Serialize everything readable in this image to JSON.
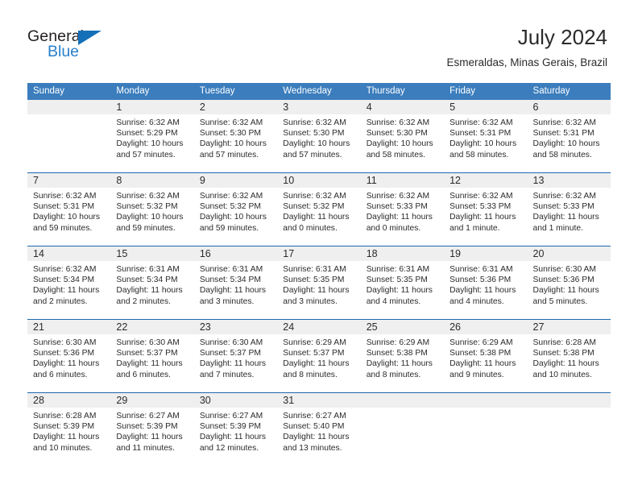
{
  "brand": {
    "word_one": "General",
    "word_two": "Blue",
    "triangle_icon": "triangle-icon",
    "accent_blue": "#2a7fc9",
    "dark": "#231f20"
  },
  "header": {
    "month_title": "July 2024",
    "location": "Esmeraldas, Minas Gerais, Brazil"
  },
  "calendar": {
    "header_bg": "#3b7dbd",
    "week_divider": "#1f69ad",
    "day_band_bg": "#efefef",
    "weekdays": [
      "Sunday",
      "Monday",
      "Tuesday",
      "Wednesday",
      "Thursday",
      "Friday",
      "Saturday"
    ],
    "weeks": [
      [
        {
          "day": "",
          "lines": []
        },
        {
          "day": "1",
          "lines": [
            "Sunrise: 6:32 AM",
            "Sunset: 5:29 PM",
            "Daylight: 10 hours",
            "and 57 minutes."
          ]
        },
        {
          "day": "2",
          "lines": [
            "Sunrise: 6:32 AM",
            "Sunset: 5:30 PM",
            "Daylight: 10 hours",
            "and 57 minutes."
          ]
        },
        {
          "day": "3",
          "lines": [
            "Sunrise: 6:32 AM",
            "Sunset: 5:30 PM",
            "Daylight: 10 hours",
            "and 57 minutes."
          ]
        },
        {
          "day": "4",
          "lines": [
            "Sunrise: 6:32 AM",
            "Sunset: 5:30 PM",
            "Daylight: 10 hours",
            "and 58 minutes."
          ]
        },
        {
          "day": "5",
          "lines": [
            "Sunrise: 6:32 AM",
            "Sunset: 5:31 PM",
            "Daylight: 10 hours",
            "and 58 minutes."
          ]
        },
        {
          "day": "6",
          "lines": [
            "Sunrise: 6:32 AM",
            "Sunset: 5:31 PM",
            "Daylight: 10 hours",
            "and 58 minutes."
          ]
        }
      ],
      [
        {
          "day": "7",
          "lines": [
            "Sunrise: 6:32 AM",
            "Sunset: 5:31 PM",
            "Daylight: 10 hours",
            "and 59 minutes."
          ]
        },
        {
          "day": "8",
          "lines": [
            "Sunrise: 6:32 AM",
            "Sunset: 5:32 PM",
            "Daylight: 10 hours",
            "and 59 minutes."
          ]
        },
        {
          "day": "9",
          "lines": [
            "Sunrise: 6:32 AM",
            "Sunset: 5:32 PM",
            "Daylight: 10 hours",
            "and 59 minutes."
          ]
        },
        {
          "day": "10",
          "lines": [
            "Sunrise: 6:32 AM",
            "Sunset: 5:32 PM",
            "Daylight: 11 hours",
            "and 0 minutes."
          ]
        },
        {
          "day": "11",
          "lines": [
            "Sunrise: 6:32 AM",
            "Sunset: 5:33 PM",
            "Daylight: 11 hours",
            "and 0 minutes."
          ]
        },
        {
          "day": "12",
          "lines": [
            "Sunrise: 6:32 AM",
            "Sunset: 5:33 PM",
            "Daylight: 11 hours",
            "and 1 minute."
          ]
        },
        {
          "day": "13",
          "lines": [
            "Sunrise: 6:32 AM",
            "Sunset: 5:33 PM",
            "Daylight: 11 hours",
            "and 1 minute."
          ]
        }
      ],
      [
        {
          "day": "14",
          "lines": [
            "Sunrise: 6:32 AM",
            "Sunset: 5:34 PM",
            "Daylight: 11 hours",
            "and 2 minutes."
          ]
        },
        {
          "day": "15",
          "lines": [
            "Sunrise: 6:31 AM",
            "Sunset: 5:34 PM",
            "Daylight: 11 hours",
            "and 2 minutes."
          ]
        },
        {
          "day": "16",
          "lines": [
            "Sunrise: 6:31 AM",
            "Sunset: 5:34 PM",
            "Daylight: 11 hours",
            "and 3 minutes."
          ]
        },
        {
          "day": "17",
          "lines": [
            "Sunrise: 6:31 AM",
            "Sunset: 5:35 PM",
            "Daylight: 11 hours",
            "and 3 minutes."
          ]
        },
        {
          "day": "18",
          "lines": [
            "Sunrise: 6:31 AM",
            "Sunset: 5:35 PM",
            "Daylight: 11 hours",
            "and 4 minutes."
          ]
        },
        {
          "day": "19",
          "lines": [
            "Sunrise: 6:31 AM",
            "Sunset: 5:36 PM",
            "Daylight: 11 hours",
            "and 4 minutes."
          ]
        },
        {
          "day": "20",
          "lines": [
            "Sunrise: 6:30 AM",
            "Sunset: 5:36 PM",
            "Daylight: 11 hours",
            "and 5 minutes."
          ]
        }
      ],
      [
        {
          "day": "21",
          "lines": [
            "Sunrise: 6:30 AM",
            "Sunset: 5:36 PM",
            "Daylight: 11 hours",
            "and 6 minutes."
          ]
        },
        {
          "day": "22",
          "lines": [
            "Sunrise: 6:30 AM",
            "Sunset: 5:37 PM",
            "Daylight: 11 hours",
            "and 6 minutes."
          ]
        },
        {
          "day": "23",
          "lines": [
            "Sunrise: 6:30 AM",
            "Sunset: 5:37 PM",
            "Daylight: 11 hours",
            "and 7 minutes."
          ]
        },
        {
          "day": "24",
          "lines": [
            "Sunrise: 6:29 AM",
            "Sunset: 5:37 PM",
            "Daylight: 11 hours",
            "and 8 minutes."
          ]
        },
        {
          "day": "25",
          "lines": [
            "Sunrise: 6:29 AM",
            "Sunset: 5:38 PM",
            "Daylight: 11 hours",
            "and 8 minutes."
          ]
        },
        {
          "day": "26",
          "lines": [
            "Sunrise: 6:29 AM",
            "Sunset: 5:38 PM",
            "Daylight: 11 hours",
            "and 9 minutes."
          ]
        },
        {
          "day": "27",
          "lines": [
            "Sunrise: 6:28 AM",
            "Sunset: 5:38 PM",
            "Daylight: 11 hours",
            "and 10 minutes."
          ]
        }
      ],
      [
        {
          "day": "28",
          "lines": [
            "Sunrise: 6:28 AM",
            "Sunset: 5:39 PM",
            "Daylight: 11 hours",
            "and 10 minutes."
          ]
        },
        {
          "day": "29",
          "lines": [
            "Sunrise: 6:27 AM",
            "Sunset: 5:39 PM",
            "Daylight: 11 hours",
            "and 11 minutes."
          ]
        },
        {
          "day": "30",
          "lines": [
            "Sunrise: 6:27 AM",
            "Sunset: 5:39 PM",
            "Daylight: 11 hours",
            "and 12 minutes."
          ]
        },
        {
          "day": "31",
          "lines": [
            "Sunrise: 6:27 AM",
            "Sunset: 5:40 PM",
            "Daylight: 11 hours",
            "and 13 minutes."
          ]
        },
        {
          "day": "",
          "lines": []
        },
        {
          "day": "",
          "lines": []
        },
        {
          "day": "",
          "lines": []
        }
      ]
    ]
  }
}
